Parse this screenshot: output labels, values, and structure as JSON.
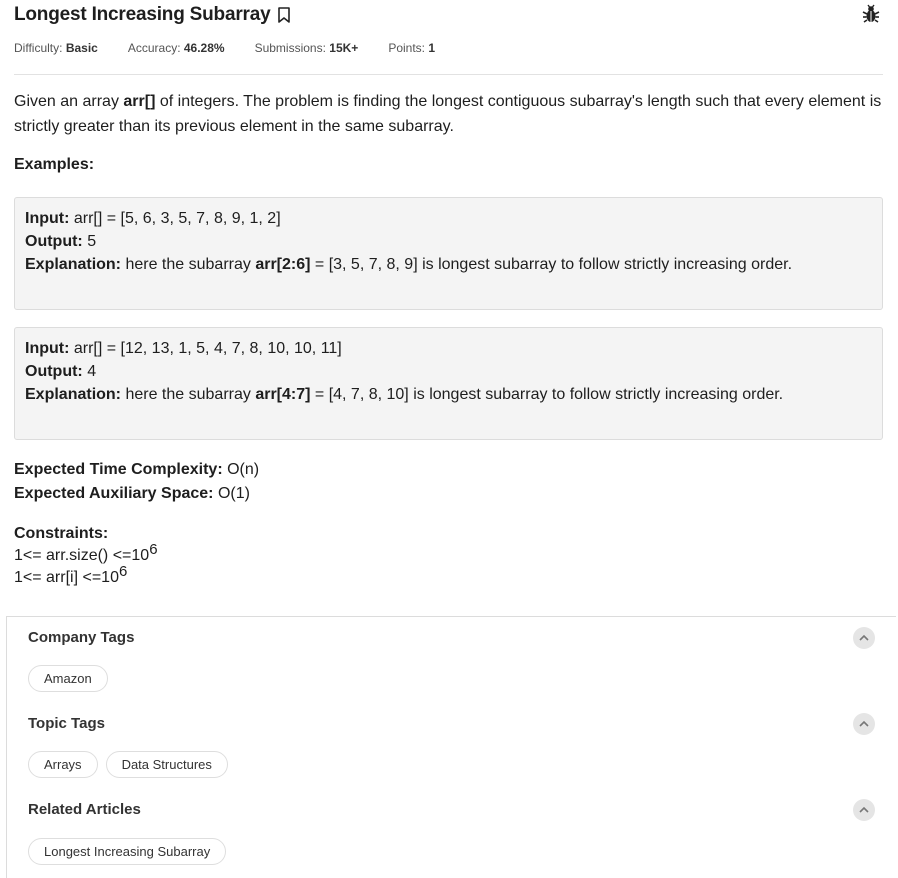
{
  "problem": {
    "title": "Longest Increasing Subarray",
    "meta": {
      "difficulty_label": "Difficulty:",
      "difficulty_value": "Basic",
      "accuracy_label": "Accuracy:",
      "accuracy_value": "46.28%",
      "submissions_label": "Submissions:",
      "submissions_value": "15K+",
      "points_label": "Points:",
      "points_value": "1"
    },
    "description": {
      "part1": "Given an array ",
      "bold": "arr[]",
      "part2": " of integers. The problem is finding the longest contiguous subarray's length such that every element is strictly greater than its previous element in the same subarray."
    },
    "examples_label": "Examples:",
    "examples": [
      {
        "input_label": "Input:",
        "input_value": " arr[] = [5, 6, 3, 5, 7, 8, 9, 1, 2]",
        "output_label": "Output:",
        "output_value": " 5",
        "explanation_label": "Explanation:",
        "expl_pre": " here the subarray ",
        "expl_bold": "arr[2:6]",
        "expl_post": " = [3, 5, 7, 8, 9] is longest subarray to follow strictly increasing order."
      },
      {
        "input_label": "Input:",
        "input_value": " arr[] = [12, 13, 1, 5, 4, 7, 8, 10, 10, 11]",
        "output_label": "Output:",
        "output_value": " 4",
        "explanation_label": "Explanation:",
        "expl_pre": " here the subarray ",
        "expl_bold": "arr[4:7]",
        "expl_post": " = [4, 7, 8, 10] is longest subarray to follow strictly increasing order."
      }
    ],
    "time_label": "Expected Time Complexity:",
    "time_value": " O(n)",
    "space_label": "Expected Auxiliary Space:",
    "space_value": " O(1)",
    "constraints_label": "Constraints:",
    "constraint1_base": "1<= arr.size() <=10",
    "constraint1_exp": "6",
    "constraint2_base": "1<= arr[i] <=10",
    "constraint2_exp": "6"
  },
  "tags": {
    "company_title": "Company Tags",
    "company": [
      "Amazon"
    ],
    "topic_title": "Topic Tags",
    "topic": [
      "Arrays",
      "Data Structures"
    ],
    "related_title": "Related Articles",
    "related": [
      "Longest Increasing Subarray"
    ]
  },
  "icons": {
    "bookmark": "bookmark-icon",
    "bug": "bug-icon",
    "collapse": "chevron-up-icon"
  },
  "colors": {
    "text": "#1e1e1e",
    "example_bg": "#f4f4f4",
    "chip_border": "#dedede"
  }
}
